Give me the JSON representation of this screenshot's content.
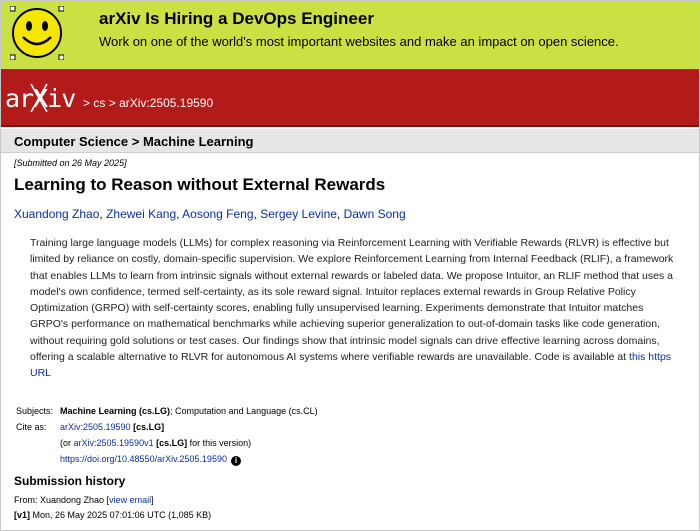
{
  "banner": {
    "title": "arXiv Is Hiring a DevOps Engineer",
    "subtitle": "Work on one of the world's most important websites and make an impact on open science."
  },
  "header": {
    "logo_text": "arXiv",
    "crumb_sep": ">",
    "crumbs": [
      "cs",
      "arXiv:2505.19590"
    ]
  },
  "subject_bar": "Computer Science > Machine Learning",
  "paper": {
    "submitted": "[Submitted on 26 May 2025]",
    "title": "Learning to Reason without External Rewards",
    "authors": [
      "Xuandong Zhao",
      "Zhewei Kang",
      "Aosong Feng",
      "Sergey Levine",
      "Dawn Song"
    ],
    "abstract": "Training large language models (LLMs) for complex reasoning via Reinforcement Learning with Verifiable Rewards (RLVR) is effective but limited by reliance on costly, domain-specific supervision. We explore Reinforcement Learning from Internal Feedback (RLIF), a framework that enables LLMs to learn from intrinsic signals without external rewards or labeled data. We propose Intuitor, an RLIF method that uses a model's own confidence, termed self-certainty, as its sole reward signal. Intuitor replaces external rewards in Group Relative Policy Optimization (GRPO) with self-certainty scores, enabling fully unsupervised learning. Experiments demonstrate that Intuitor matches GRPO's performance on mathematical benchmarks while achieving superior generalization to out-of-domain tasks like code generation, without requiring gold solutions or test cases. Our findings show that intrinsic model signals can drive effective learning across domains, offering a scalable alternative to RLVR for autonomous AI systems where verifiable rewards are unavailable. Code is available at",
    "abstract_link": "this https URL"
  },
  "meta": {
    "subjects_label": "Subjects:",
    "subjects_primary": "Machine Learning (cs.LG)",
    "subjects_rest": "; Computation and Language (cs.CL)",
    "cite_label": "Cite as:",
    "cite_id": "arXiv:2505.19590",
    "cite_cat": "[cs.LG]",
    "version_prefix": "(or",
    "version_id": "arXiv:2505.19590v1",
    "version_cat": "[cs.LG]",
    "version_suffix": "for this version)",
    "doi": "https://doi.org/10.48550/arXiv.2505.19590",
    "info_icon_glyph": "i"
  },
  "history": {
    "title": "Submission history",
    "from_prefix": "From: Xuandong Zhao [",
    "from_link": "view email",
    "from_suffix": "]",
    "v1_label": "[v1]",
    "v1_text": "Mon, 26 May 2025 07:01:06 UTC (1,085 KB)"
  },
  "colors": {
    "banner_bg": "#cbe043",
    "header_red": "#b31b1b",
    "link_blue": "#0a2f9b",
    "subject_bar_bg": "#e6e6e6"
  }
}
